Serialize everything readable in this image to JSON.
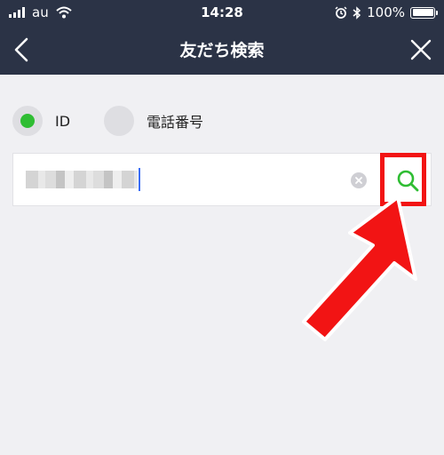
{
  "status_bar": {
    "carrier": "au",
    "time": "14:28",
    "battery_text": "100%",
    "battery_level": 1.0
  },
  "header": {
    "title": "友だち検索"
  },
  "search_type": {
    "options": [
      {
        "label": "ID",
        "selected": true
      },
      {
        "label": "電話番号",
        "selected": false
      }
    ]
  },
  "search": {
    "value_masked": true
  },
  "colors": {
    "header_bg": "#2b3346",
    "accent_green": "#2fbd33",
    "annotation_red": "#f21414"
  }
}
